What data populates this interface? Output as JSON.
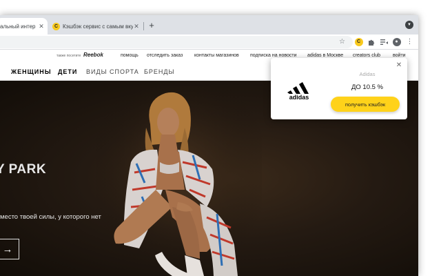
{
  "browser": {
    "tabs": [
      {
        "title": "альный интер",
        "active": true
      },
      {
        "title": "Кэшбэк сервис с самым вкус",
        "active": false
      }
    ],
    "new_tab_label": "+",
    "close_glyph": "✕"
  },
  "extensions": {
    "cashback_ext_letter": "C",
    "tab_favicon_letter": "C"
  },
  "site": {
    "top_links": {
      "also_visit": "также посетите",
      "reebok": "Reebok",
      "items": [
        "помощь",
        "отследить заказ",
        "контакты магазинов",
        "подписка на новости",
        "adidas в Москве",
        "creators club",
        "войти"
      ]
    },
    "main_nav": {
      "items": [
        "ЖЕНЩИНЫ",
        "ДЕТИ",
        "ВИДЫ СПОРТА",
        "БРЕНДЫ"
      ]
    },
    "hero": {
      "title": "Y PARK",
      "subtitle": "место твоей силы, у которого нет",
      "arrow": "→"
    }
  },
  "popup": {
    "store_name": "Adidas",
    "cashback_rate": "ДО 10.5 %",
    "button_label": "получить кэшбэк",
    "logo_text": "adidas",
    "close_glyph": "✕"
  },
  "colors": {
    "accent_yellow": "#ffd21a",
    "favicon_yellow": "#f8c91d",
    "hero_dark": "#241a12"
  }
}
